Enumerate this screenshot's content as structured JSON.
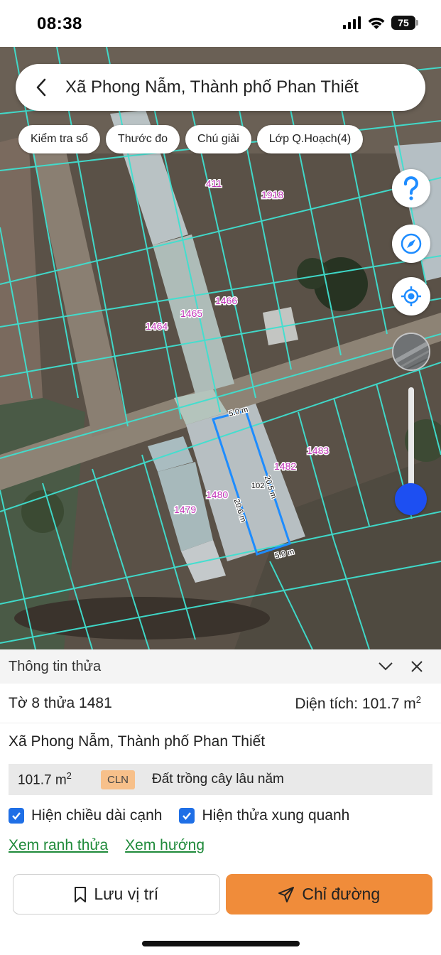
{
  "status_bar": {
    "time": "08:38",
    "battery": "75"
  },
  "search": {
    "title": "Xã Phong Nẫm, Thành phố Phan Thiết"
  },
  "chips": [
    "Kiểm tra sổ",
    "Thước đo",
    "Chú giải",
    "Lớp Q.Hoạch(4)"
  ],
  "map_controls": [
    "help-icon",
    "compass-icon",
    "locate-icon",
    "map-layer-thumbnail",
    "zoom-slider"
  ],
  "parcel_labels": {
    "p411": "411",
    "p1918": "1918",
    "p1466": "1466",
    "p1465": "1465",
    "p1464": "1464",
    "p1483": "1483",
    "p1482": "1482",
    "p1480": "1480",
    "p1479": "1479"
  },
  "dimensions": {
    "top": "5.0 m",
    "bottom": "5.0 m",
    "left": "20.6 m",
    "right": "20.5 m",
    "center": "102"
  },
  "sheet": {
    "title": "Thông tin thửa",
    "parcel_id": "Tờ 8 thửa 1481",
    "area_label": "Diện tích: 101.7 m",
    "area_unit_sup": "2",
    "address": "Xã Phong Nẫm, Thành phố Phan Thiết",
    "landuse": {
      "area": "101.7 m",
      "area_sup": "2",
      "code": "CLN",
      "name": "Đất trồng cây lâu năm"
    },
    "checkbox_edges": "Hiện chiều dài cạnh",
    "checkbox_neighbors": "Hiện thửa xung quanh",
    "link_boundary": "Xem ranh thửa",
    "link_direction": "Xem hướng",
    "save_button": "Lưu vị trí",
    "directions_button": "Chỉ đường"
  },
  "colors": {
    "accent_orange": "#f08c3a",
    "checkbox_blue": "#1f6fe6",
    "link_green": "#1f8a3a",
    "parcel_line": "#3fe0d0",
    "selected_parcel": "#1e8cff"
  }
}
